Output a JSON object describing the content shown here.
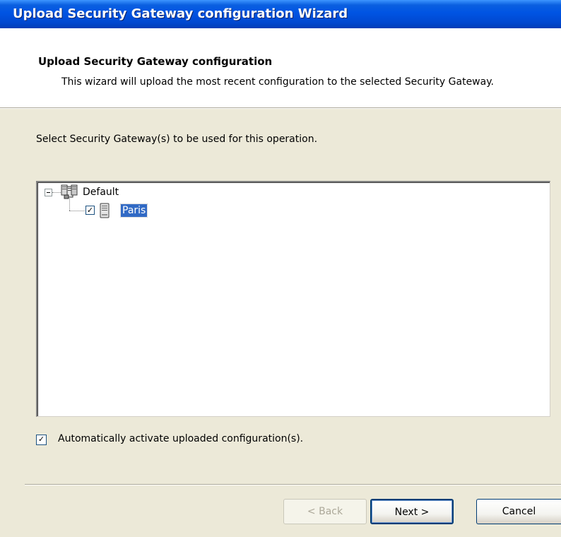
{
  "window": {
    "title": "Upload Security Gateway configuration Wizard"
  },
  "header": {
    "title": "Upload Security Gateway configuration",
    "subtitle": "This wizard will upload the most recent configuration to the selected Security Gateway."
  },
  "body": {
    "prompt": "Select Security Gateway(s) to be used for this operation.",
    "tree": {
      "root": {
        "label": "Default",
        "expanded": true,
        "icon": "server-group-icon",
        "children": [
          {
            "label": "Paris",
            "checked": true,
            "selected": true,
            "icon": "server-icon"
          }
        ]
      }
    },
    "auto_activate": {
      "label": "Automatically activate uploaded configuration(s).",
      "checked": true
    }
  },
  "buttons": {
    "back": "< Back",
    "next": "Next >",
    "cancel": "Cancel"
  },
  "colors": {
    "titlebar": "#0054e3",
    "selection": "#316ac5",
    "dialog_bg": "#ece9d8"
  }
}
